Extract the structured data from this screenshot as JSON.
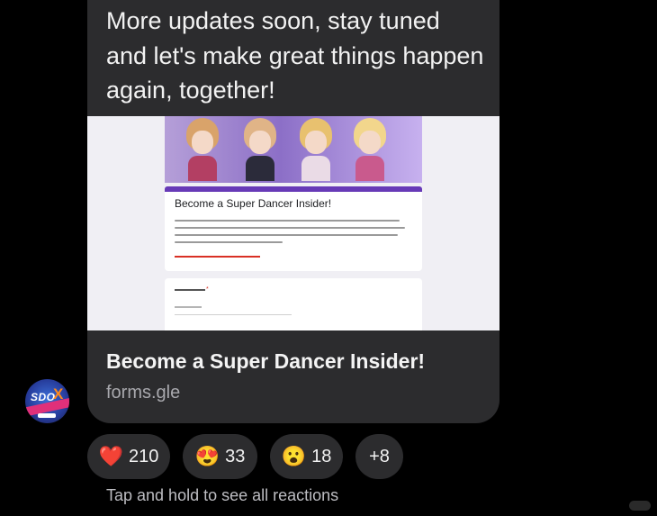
{
  "message": {
    "text": "More updates soon, stay tuned and let's make great things happen again, together!"
  },
  "link_preview": {
    "form_title": "Become a Super Dancer Insider!",
    "title": "Become a Super Dancer Insider!",
    "domain": "forms.gle"
  },
  "sender": {
    "avatar_text": "SDO",
    "avatar_mark": "X"
  },
  "reactions": [
    {
      "emoji": "❤️",
      "count": "210",
      "icon": "red-heart-icon"
    },
    {
      "emoji": "😍",
      "count": "33",
      "icon": "heart-eyes-icon"
    },
    {
      "emoji": "😮",
      "count": "18",
      "icon": "surprised-face-icon"
    },
    {
      "more": "+8"
    }
  ],
  "hint": "Tap and hold to see all reactions",
  "colors": {
    "background": "#000000",
    "bubble": "#2c2c2e",
    "form_accent": "#673ab7"
  }
}
